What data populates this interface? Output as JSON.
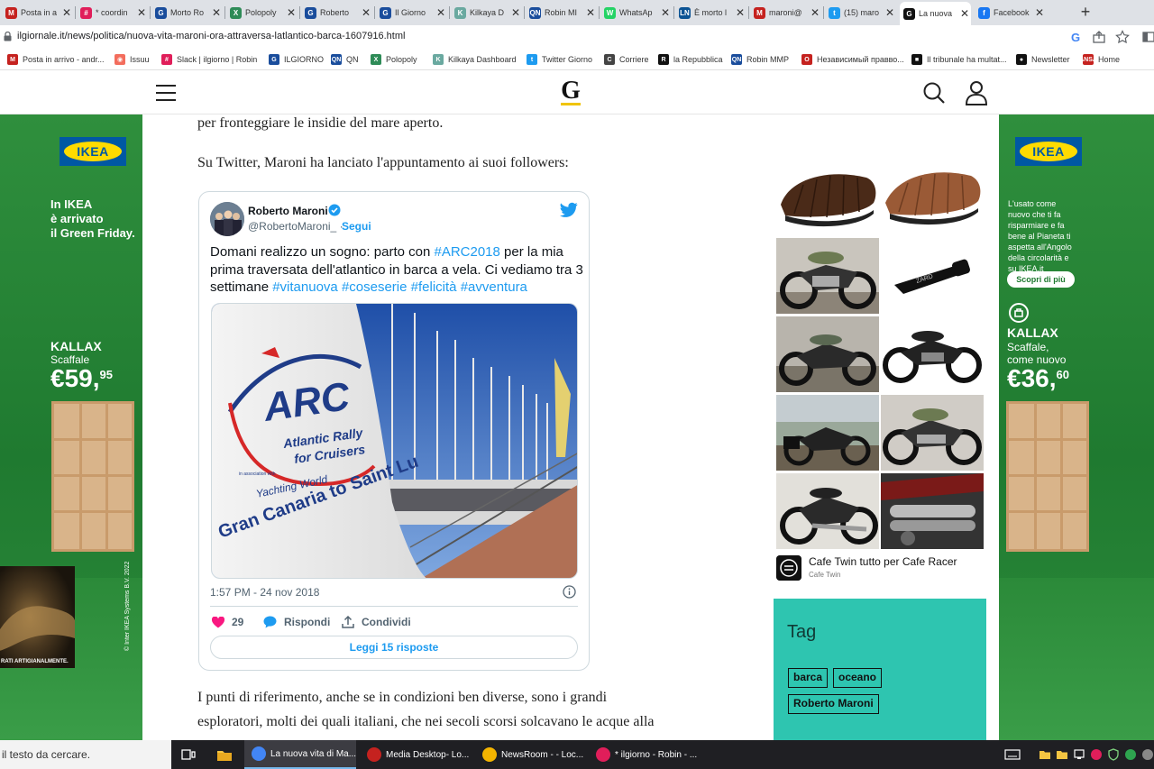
{
  "browser": {
    "tabs": [
      {
        "label": "Posta in a",
        "color": "#c5221f",
        "fav": "M"
      },
      {
        "label": "* coordin",
        "color": "#e01e5a",
        "fav": "#"
      },
      {
        "label": "Morto Ro",
        "color": "#1a4d9c",
        "fav": "G"
      },
      {
        "label": "Polopoly",
        "color": "#2e8b57",
        "fav": "X"
      },
      {
        "label": "Roberto",
        "color": "#1a4d9c",
        "fav": "G"
      },
      {
        "label": "Il Giorno",
        "color": "#1a4d9c",
        "fav": "G"
      },
      {
        "label": "Kilkaya D",
        "color": "#6aa9a0",
        "fav": "K"
      },
      {
        "label": "Robin MI",
        "color": "#1a4d9c",
        "fav": "QN"
      },
      {
        "label": "WhatsAp",
        "color": "#25d366",
        "fav": "W"
      },
      {
        "label": "È morto l",
        "color": "#0b5394",
        "fav": "LN"
      },
      {
        "label": "maroni@",
        "color": "#c5221f",
        "fav": "M"
      },
      {
        "label": "(15) maro",
        "color": "#1d9bf0",
        "fav": "t"
      },
      {
        "label": "La nuova",
        "color": "#111111",
        "fav": "G"
      },
      {
        "label": "Facebook",
        "color": "#1877f2",
        "fav": "f"
      }
    ],
    "new_tab": "+",
    "url": "ilgiornale.it/news/politica/nuova-vita-maroni-ora-attraversa-latlantico-barca-1607916.html",
    "bookmarks": [
      {
        "label": "Posta in arrivo - andr...",
        "color": "#c5221f",
        "fav": "M"
      },
      {
        "label": "Issuu",
        "color": "#f36d5d",
        "fav": "◉"
      },
      {
        "label": "Slack | ilgiorno | Robin",
        "color": "#e01e5a",
        "fav": "#"
      },
      {
        "label": "ILGIORNO",
        "color": "#1a4d9c",
        "fav": "G"
      },
      {
        "label": "QN",
        "color": "#1a4d9c",
        "fav": "QN"
      },
      {
        "label": "Polopoly",
        "color": "#2e8b57",
        "fav": "X"
      },
      {
        "label": "Kilkaya Dashboard",
        "color": "#6aa9a0",
        "fav": "K"
      },
      {
        "label": "Twitter Giorno",
        "color": "#1d9bf0",
        "fav": "t"
      },
      {
        "label": "Corriere",
        "color": "#444",
        "fav": "C"
      },
      {
        "label": "la Repubblica",
        "color": "#111",
        "fav": "R"
      },
      {
        "label": "Robin MMP",
        "color": "#1a4d9c",
        "fav": "QN"
      },
      {
        "label": "Независимый правво...",
        "color": "#c5221f",
        "fav": "O"
      },
      {
        "label": "Il tribunale ha multat...",
        "color": "#111",
        "fav": "■"
      },
      {
        "label": "Newsletter",
        "color": "#111",
        "fav": "●"
      },
      {
        "label": "Home",
        "color": "#c5221f",
        "fav": "ANSA"
      }
    ]
  },
  "site": {
    "logo": "G"
  },
  "article": {
    "p_top": "per fronteggiare le insidie del mare aperto.",
    "p_twitter": "Su Twitter, Maroni ha lanciato l'appuntamento ai suoi followers:",
    "p_bottom_1": "I punti di riferimento, anche se in condizioni ben diverse, sono i grandi",
    "p_bottom_2": "esploratori, molti dei quali italiani, che nei secoli scorsi solcavano le acque alla"
  },
  "tweet": {
    "name": "Roberto Maroni",
    "handle": "@RobertoMaroni_",
    "separator": "·",
    "follow": "Segui",
    "text_a": "Domani realizzo un sogno: parto con ",
    "tag_arc": "#ARC2018",
    "text_b": " per la mia prima traversata dell'atlantico in barca a vela. Ci vediamo tra 3 settimane ",
    "tag_1": "#vitanuova",
    "tag_2": "#coseserie",
    "tag_3": "#felicità",
    "tag_4": "#avventura",
    "flag_arc": "ARC",
    "flag_line1": "Atlantic Rally",
    "flag_line2": "for Cruisers",
    "flag_assoc": "in association with",
    "flag_yw": "Yachting World",
    "flag_route": "Gran Canaria to Saint Lu",
    "time": "1:57 PM - 24 nov 2018",
    "likes": "29",
    "reply": "Rispondi",
    "share": "Condividi",
    "read_replies": "Leggi 15 risposte"
  },
  "skin_left": {
    "brand": "IKEA",
    "headline_1": "In IKEA",
    "headline_2": "è arrivato",
    "headline_3": "il Green Friday.",
    "product": "KALLAX",
    "product_type": "Scaffale",
    "price_main": "€59,",
    "price_cents": "95",
    "legal": "© Inter IKEA Systems B.V. 2022"
  },
  "skin_right": {
    "brand": "IKEA",
    "body_1": "L'usato come",
    "body_2": "nuovo che ti fa",
    "body_3": "risparmiare e fa",
    "body_4": "bene al Pianeta ti",
    "body_5": "aspetta all'Angolo",
    "body_6": "della circolarità e",
    "body_7": "su IKEA.it",
    "cta": "Scopri di più",
    "product": "KALLAX",
    "product_type_1": "Scaffale,",
    "product_type_2": "come nuovo",
    "price_main": "€36,",
    "price_cents": "60"
  },
  "video_ad": {
    "caption": "RATI ARTIGIANALMENTE."
  },
  "ad": {
    "choices": "▷ ✕",
    "product_brand": "ZARD",
    "title": "Cafe Twin tutto per Cafe Racer",
    "advertiser": "Cafe Twin"
  },
  "tags": {
    "title": "Tag",
    "items": [
      "barca",
      "oceano",
      "Roberto Maroni"
    ]
  },
  "taskbar": {
    "search": "il testo da cercare.",
    "apps": [
      {
        "label": "La nuova vita di Ma...",
        "color": "#4285f4"
      },
      {
        "label": "Media Desktop- Lo...",
        "color": "#c5221f"
      },
      {
        "label": "NewsRoom - - Loc...",
        "color": "#f4b400"
      },
      {
        "label": "* ilgiorno - Robin - ...",
        "color": "#e01e5a"
      }
    ]
  }
}
